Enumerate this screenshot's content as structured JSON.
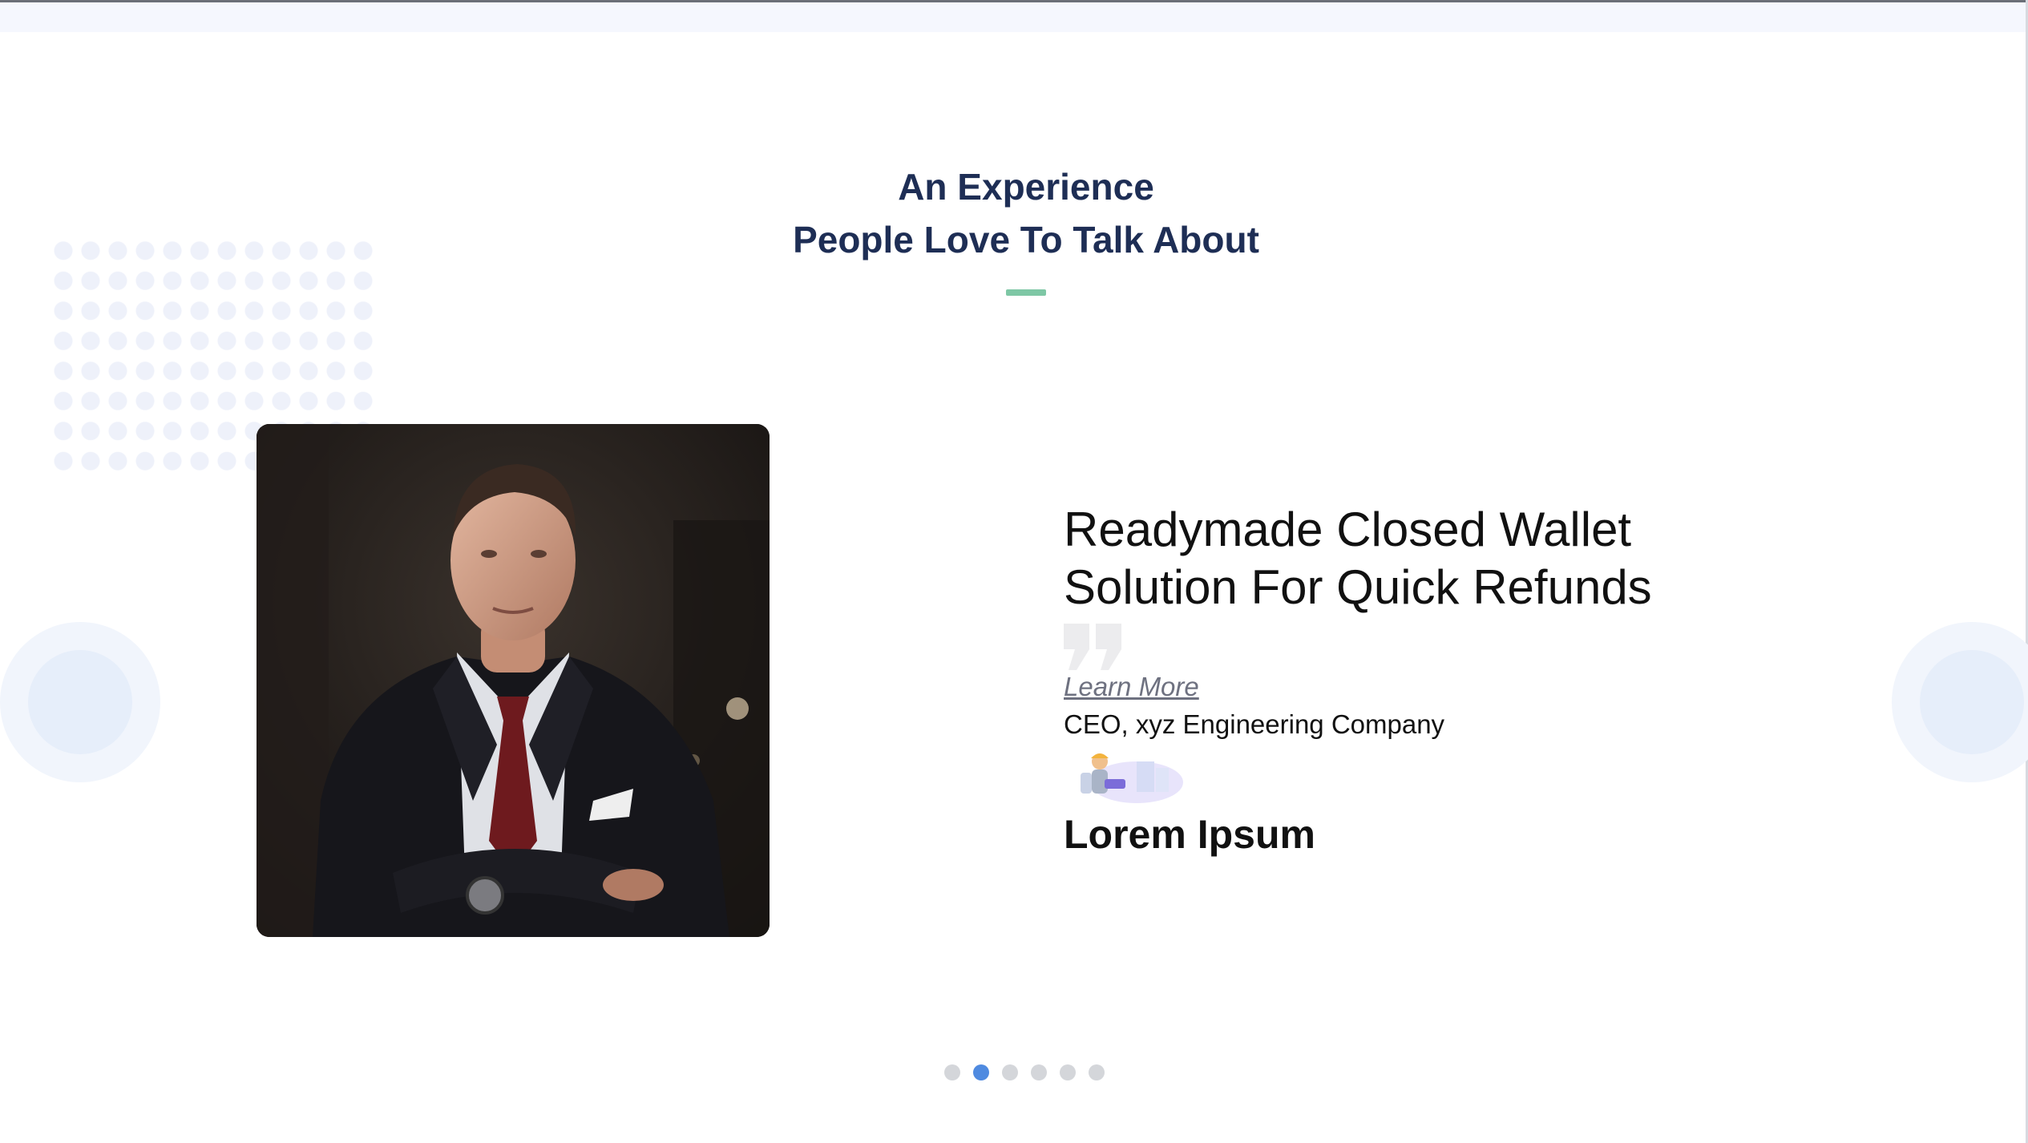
{
  "section": {
    "heading_line1": "An Experience",
    "heading_line2": "People Love To Talk About"
  },
  "slide": {
    "title_line1": "Readymade Closed Wallet",
    "title_line2": "Solution For Quick Refunds",
    "link_label": "Learn More",
    "role": "CEO, xyz Engineering Company",
    "name": "Lorem Ipsum"
  },
  "carousel": {
    "total_slides": 6,
    "active_index": 1
  },
  "colors": {
    "heading": "#1e2e55",
    "accent_bar": "#7ec7a5",
    "active_dot": "#4f8ae0",
    "inactive_dot": "#d4d6da"
  }
}
